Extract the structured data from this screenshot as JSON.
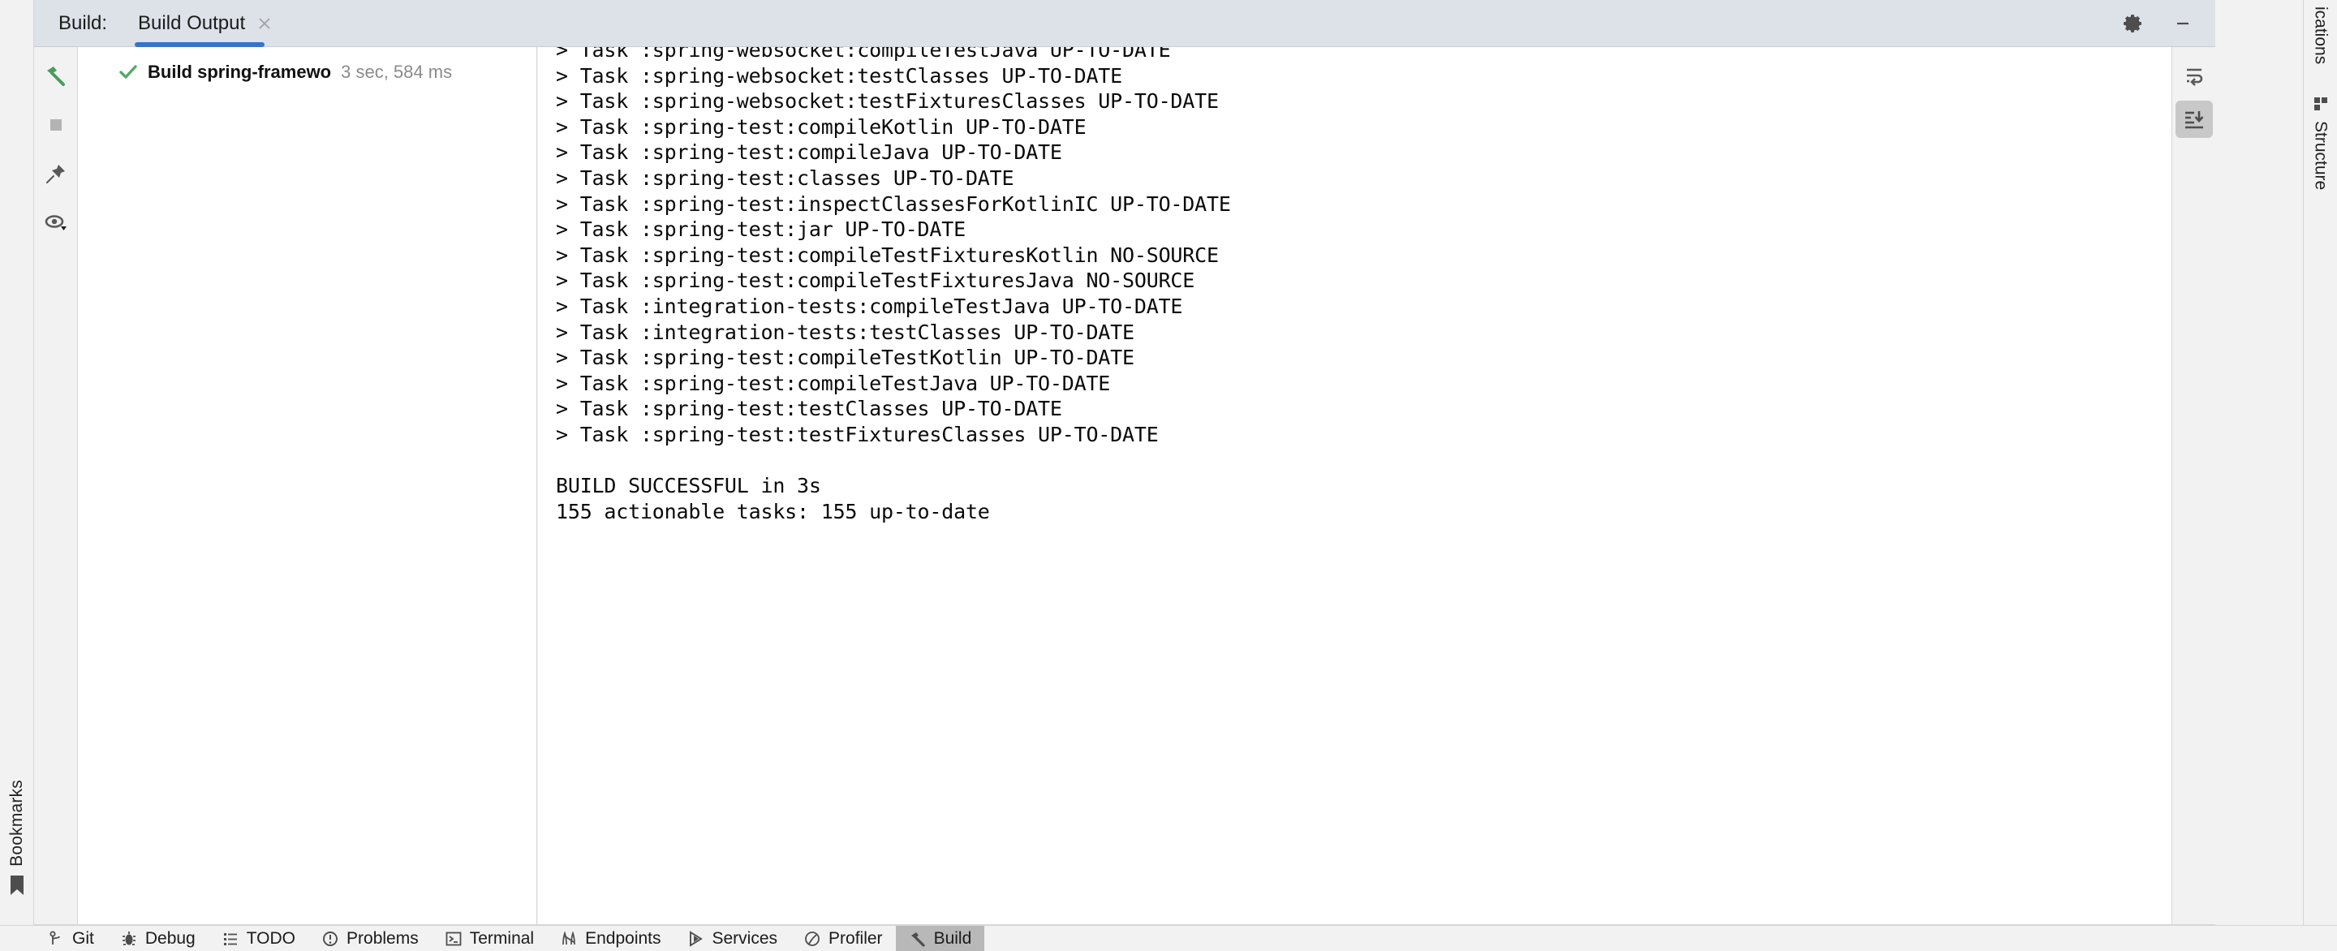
{
  "window": {
    "tool_window_title": "Build:",
    "tab_label": "Build Output",
    "close_icon": "close-icon",
    "settings_icon": "gear-icon",
    "minimize_icon": "minimize-icon"
  },
  "left_toolbar": {
    "buttons": [
      {
        "name": "rerun-build-button",
        "icon": "hammer-icon",
        "color": "#4a9c5d"
      },
      {
        "name": "stop-build-button",
        "icon": "stop-square-icon",
        "color": "#b3b3b3"
      },
      {
        "name": "pin-tab-button",
        "icon": "pin-icon",
        "color": "#585858"
      },
      {
        "name": "toggle-view-button",
        "icon": "eye-dropdown-icon",
        "color": "#585858"
      }
    ]
  },
  "build_tree": {
    "rows": [
      {
        "status_icon": "green-check-icon",
        "label": "Build spring-framewo",
        "duration": "3 sec, 584 ms"
      }
    ]
  },
  "console": {
    "lines": [
      "> Task :spring-websocket:compileTestJava UP-TO-DATE",
      "> Task :spring-websocket:testClasses UP-TO-DATE",
      "> Task :spring-websocket:testFixturesClasses UP-TO-DATE",
      "> Task :spring-test:compileKotlin UP-TO-DATE",
      "> Task :spring-test:compileJava UP-TO-DATE",
      "> Task :spring-test:classes UP-TO-DATE",
      "> Task :spring-test:inspectClassesForKotlinIC UP-TO-DATE",
      "> Task :spring-test:jar UP-TO-DATE",
      "> Task :spring-test:compileTestFixturesKotlin NO-SOURCE",
      "> Task :spring-test:compileTestFixturesJava NO-SOURCE",
      "> Task :integration-tests:compileTestJava UP-TO-DATE",
      "> Task :integration-tests:testClasses UP-TO-DATE",
      "> Task :spring-test:compileTestKotlin UP-TO-DATE",
      "> Task :spring-test:compileTestJava UP-TO-DATE",
      "> Task :spring-test:testClasses UP-TO-DATE",
      "> Task :spring-test:testFixturesClasses UP-TO-DATE",
      "",
      "BUILD SUCCESSFUL in 3s",
      "155 actionable tasks: 155 up-to-date"
    ]
  },
  "right_toolbar": {
    "buttons": [
      {
        "name": "soft-wrap-button",
        "icon": "soft-wrap-icon",
        "active": false
      },
      {
        "name": "scroll-to-end-button",
        "icon": "scroll-to-end-icon",
        "active": true
      }
    ]
  },
  "right_rail": {
    "items": [
      {
        "name": "notifications-rail-item",
        "label": "ications",
        "icon": ""
      },
      {
        "name": "structure-rail-item",
        "label": "Structure",
        "icon": "structure-icon"
      }
    ]
  },
  "left_rail": {
    "label": "Bookmarks",
    "icon": "bookmark-icon"
  },
  "statusbar": {
    "items": [
      {
        "name": "statusbar-git",
        "label": "Git",
        "icon": "git-branch-icon",
        "active": false
      },
      {
        "name": "statusbar-debug",
        "label": "Debug",
        "icon": "bug-icon",
        "active": false
      },
      {
        "name": "statusbar-todo",
        "label": "TODO",
        "icon": "list-icon",
        "active": false
      },
      {
        "name": "statusbar-problems",
        "label": "Problems",
        "icon": "warning-circle-icon",
        "active": false
      },
      {
        "name": "statusbar-terminal",
        "label": "Terminal",
        "icon": "terminal-icon",
        "active": false
      },
      {
        "name": "statusbar-endpoints",
        "label": "Endpoints",
        "icon": "endpoints-icon",
        "active": false
      },
      {
        "name": "statusbar-services",
        "label": "Services",
        "icon": "services-icon",
        "active": false
      },
      {
        "name": "statusbar-profiler",
        "label": "Profiler",
        "icon": "profiler-icon",
        "active": false
      },
      {
        "name": "statusbar-build",
        "label": "Build",
        "icon": "hammer-icon",
        "active": true
      }
    ]
  },
  "colors": {
    "header_bg": "#dde1e8",
    "tab_underline": "#3574ce",
    "panel_bg": "#f2f2f2",
    "console_bg": "#ffffff",
    "success_green": "#59a869",
    "active_tab_bg": "#b8b8b8"
  }
}
